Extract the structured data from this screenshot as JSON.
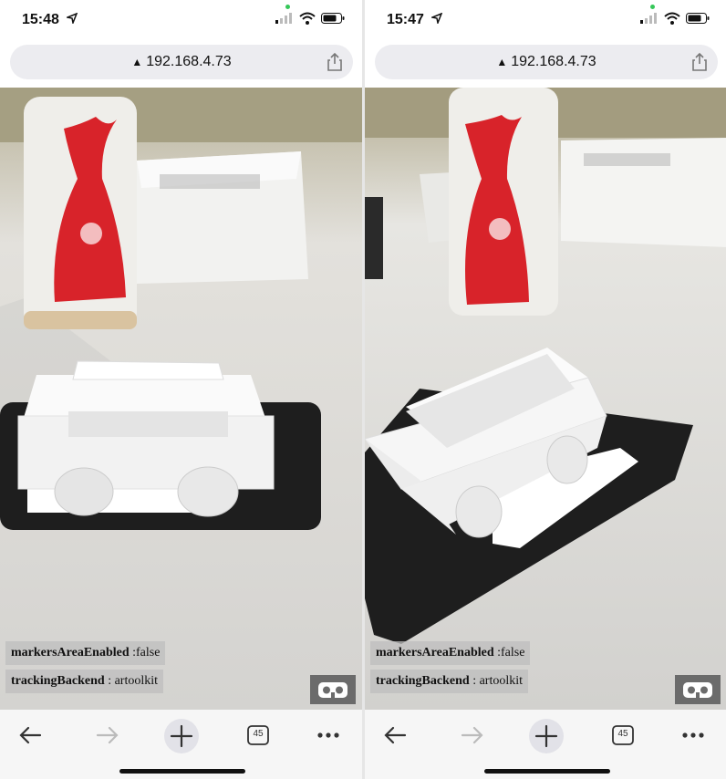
{
  "left": {
    "time": "15:48",
    "url": "192.168.4.73",
    "status1_key": "markersAreaEnabled",
    "status1_val": " :false",
    "status2_key": "trackingBackend",
    "status2_val": " : artoolkit",
    "tabs_count": "45"
  },
  "right": {
    "time": "15:47",
    "url": "192.168.4.73",
    "status1_key": "markersAreaEnabled",
    "status1_val": " :false",
    "status2_key": "trackingBackend",
    "status2_val": " : artoolkit",
    "tabs_count": "45"
  },
  "icons": [
    "location-arrow-icon",
    "signal-icon",
    "wifi-icon",
    "battery-icon",
    "warning-icon",
    "share-icon",
    "back-icon",
    "forward-icon",
    "new-tab-icon",
    "tabs-icon",
    "more-icon",
    "vr-goggles-icon"
  ],
  "colors": {
    "accent_red": "#d8232a",
    "urlbar": "#ececf0",
    "overlay": "#bebebe"
  }
}
